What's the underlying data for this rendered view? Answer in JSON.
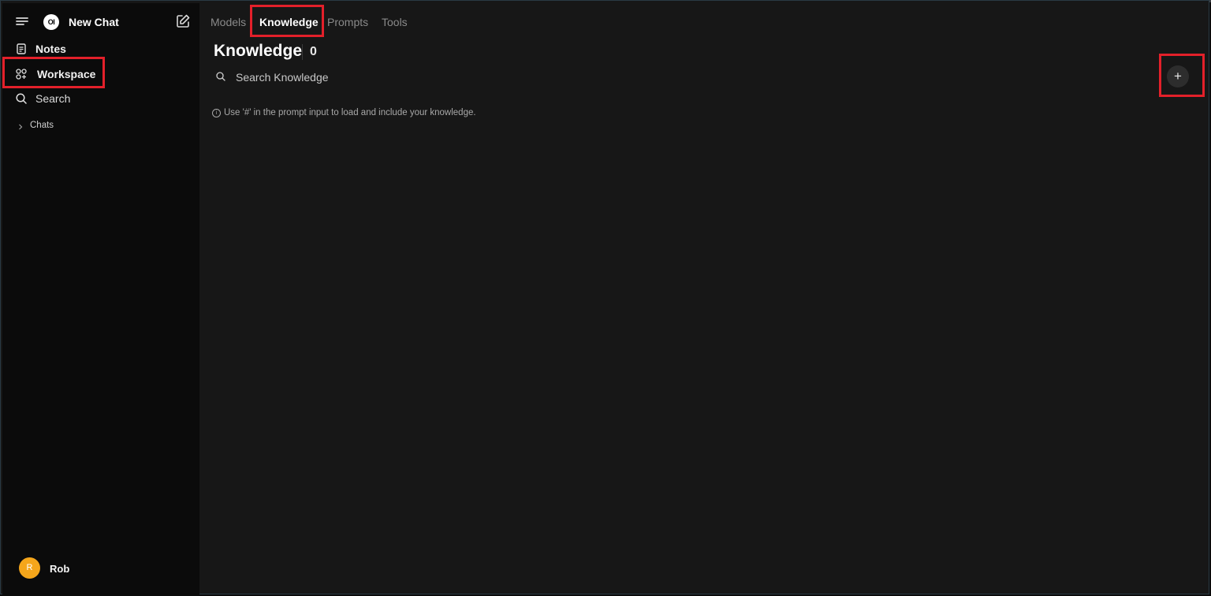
{
  "sidebar": {
    "app_name": "New Chat",
    "logo_text": "OI",
    "items": [
      {
        "label": "Notes",
        "icon": "notes-icon"
      },
      {
        "label": "Workspace",
        "icon": "workspace-icon"
      },
      {
        "label": "Search",
        "icon": "search-icon"
      }
    ],
    "chats_label": "Chats",
    "user": {
      "initial": "R",
      "name": "Rob",
      "avatar_color": "#f5a61b"
    }
  },
  "main": {
    "tabs": [
      {
        "label": "Models"
      },
      {
        "label": "Knowledge",
        "active": true
      },
      {
        "label": "Prompts"
      },
      {
        "label": "Tools"
      }
    ],
    "title": "Knowledge",
    "count": "0",
    "search": {
      "placeholder": "Search Knowledge",
      "value": ""
    },
    "add_button": "+",
    "hint": "Use '#' in the prompt input to load and include your knowledge."
  },
  "colors": {
    "highlight": "#e3202a",
    "sidebar_bg": "#0b0b0b",
    "main_bg": "#171717"
  }
}
